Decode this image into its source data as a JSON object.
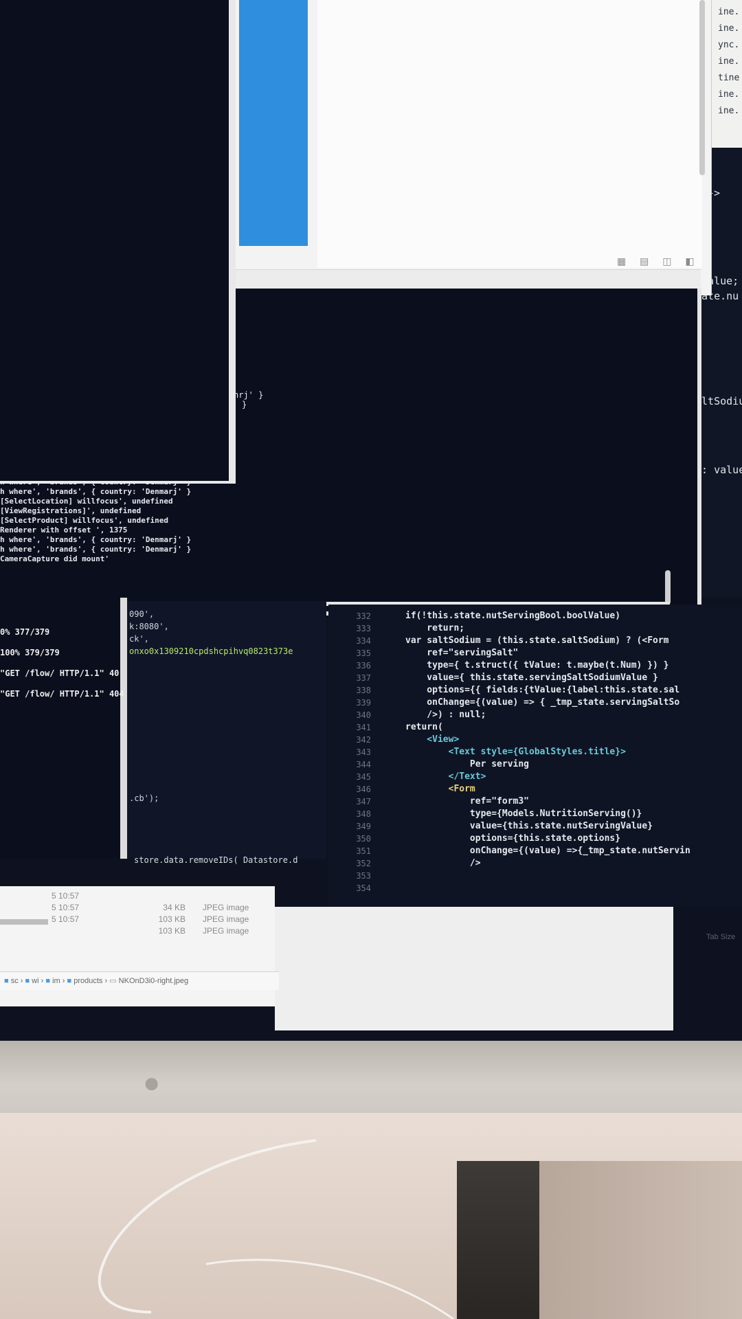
{
  "top_right_editor": {
    "lines": [
      "ine.",
      "ine.",
      "ync.",
      "ine.",
      "tine",
      "ine.",
      "ine."
    ],
    "fragment": "}>"
  },
  "right_code_fragments": [
    "dValue;",
    "tate.nu",
    "altSodiu",
    "m: value"
  ],
  "finder_toolbar": {
    "view_icons": [
      "grid-view-icon",
      "list-view-icon",
      "column-view-icon",
      "coverflow-view-icon"
    ]
  },
  "back_terminal": {
    "top_lines": [
      "nrj' }",
      "}"
    ],
    "log_lines": [
      "h where', 'brands', { country: 'Denmarj' }",
      "h where', 'brands', { country: 'Denmarj' }",
      "[SelectLocation] willfocus', undefined",
      "[ViewRegistrations]', undefined",
      "[SelectProduct] willfocus', undefined",
      "Renderer with offset ', 1375",
      "h where', 'brands', { country: 'Denmarj' }",
      "h where', 'brands', { country: 'Denmarj' }",
      "CameraCapture did mount'"
    ]
  },
  "left_terminal": {
    "lines": [
      "0% 377/379",
      "100% 379/379",
      "",
      "",
      "",
      "",
      "\"GET /flow/ HTTP/1.1\" 40",
      "",
      "",
      "",
      "",
      "\"GET /flow/ HTTP/1.1\" 404"
    ]
  },
  "middle_pane": {
    "lines": [
      "090',",
      "k:8080',",
      "ck',",
      "onxo0x1309210cpdshcpihvq0823t373e"
    ],
    "cb_line": ".cb');",
    "bottom_line": "store.data.removeIDs( Datastore.d"
  },
  "code_editor": {
    "line_numbers": [
      "332",
      "333",
      "334",
      "335",
      "336",
      "337",
      "338",
      "339",
      "340",
      "341",
      "342",
      "343",
      "344",
      "345",
      "346",
      "347",
      "348",
      "349",
      "350",
      "351",
      "352",
      "353",
      "354"
    ],
    "lines": [
      "if(!this.state.nutServingBool.boolValue)",
      "    return;",
      "",
      "var saltSodium = (this.state.saltSodium) ? (<Form",
      "    ref=\"servingSalt\"",
      "    type={ t.struct({ tValue: t.maybe(t.Num) }) }",
      "    value={ this.state.servingSaltSodiumValue }",
      "    options={{ fields:{tValue:{label:this.state.sal",
      "    onChange={(value) => { _tmp_state.servingSaltSo",
      "    />) : null;",
      "",
      "return(",
      "    <View>",
      "        <Text style={GlobalStyles.title}>",
      "            Per serving",
      "        </Text>",
      "        <Form",
      "            ref=\"form3\"",
      "            type={Models.NutritionServing()}",
      "            value={this.state.nutServingValue}",
      "            options={this.state.options}",
      "            onChange={(value) =>{_tmp_state.nutServin",
      "            />"
    ],
    "tab_size_label": "Tab Size"
  },
  "finder_files": {
    "rows": [
      {
        "date": "5 10:57",
        "size": "",
        "kind": ""
      },
      {
        "date": "5 10:57",
        "size": "34 KB",
        "kind": "JPEG image"
      },
      {
        "date": "5 10:57",
        "size": "103 KB",
        "kind": "JPEG image"
      },
      {
        "date": "",
        "size": "103 KB",
        "kind": "JPEG image"
      }
    ],
    "path": [
      "sc",
      "wi",
      "im",
      "products",
      "NKOnD3i0-right.jpeg"
    ]
  }
}
